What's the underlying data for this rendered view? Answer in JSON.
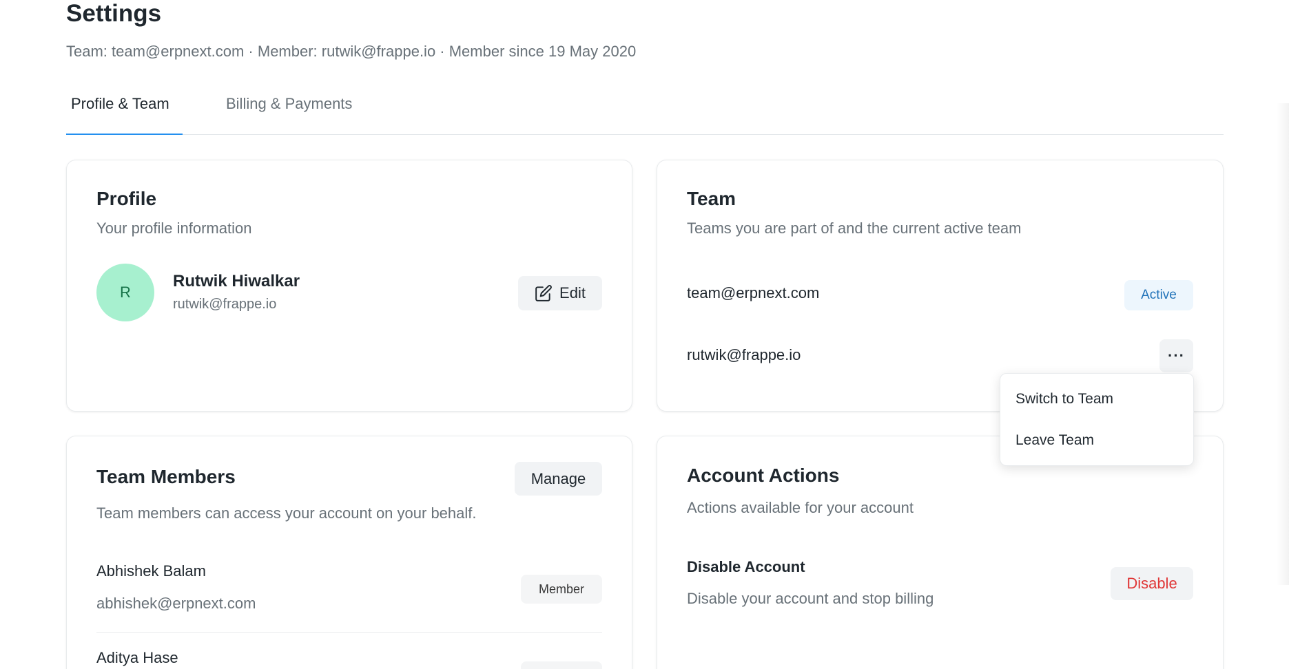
{
  "header": {
    "title": "Settings",
    "subtitle": "Team: team@erpnext.com · Member: rutwik@frappe.io · Member since 19 May 2020"
  },
  "tabs": [
    {
      "label": "Profile & Team",
      "active": true
    },
    {
      "label": "Billing & Payments",
      "active": false
    }
  ],
  "profile": {
    "title": "Profile",
    "description": "Your profile information",
    "avatar_initial": "R",
    "name": "Rutwik Hiwalkar",
    "email": "rutwik@frappe.io",
    "edit_label": "Edit"
  },
  "team": {
    "title": "Team",
    "description": "Teams you are part of and the current active team",
    "items": [
      {
        "name": "team@erpnext.com",
        "badge": "Active"
      },
      {
        "name": "rutwik@frappe.io",
        "action": "more"
      }
    ],
    "more_label": "···"
  },
  "dropdown": {
    "items": [
      "Switch to Team",
      "Leave Team"
    ]
  },
  "members": {
    "title": "Team Members",
    "manage_label": "Manage",
    "description": "Team members can access your account on your behalf.",
    "items": [
      {
        "name": "Abhishek Balam",
        "email": "abhishek@erpnext.com",
        "role": "Member"
      },
      {
        "name": "Aditya Hase",
        "email": "",
        "role": ""
      }
    ]
  },
  "account_actions": {
    "title": "Account Actions",
    "description": "Actions available for your account",
    "disable_title": "Disable Account",
    "disable_description": "Disable your account and stop billing",
    "disable_label": "Disable"
  },
  "colors": {
    "accent": "#2490ef",
    "avatar_bg": "#a7f0cf",
    "danger": "#e03636"
  }
}
